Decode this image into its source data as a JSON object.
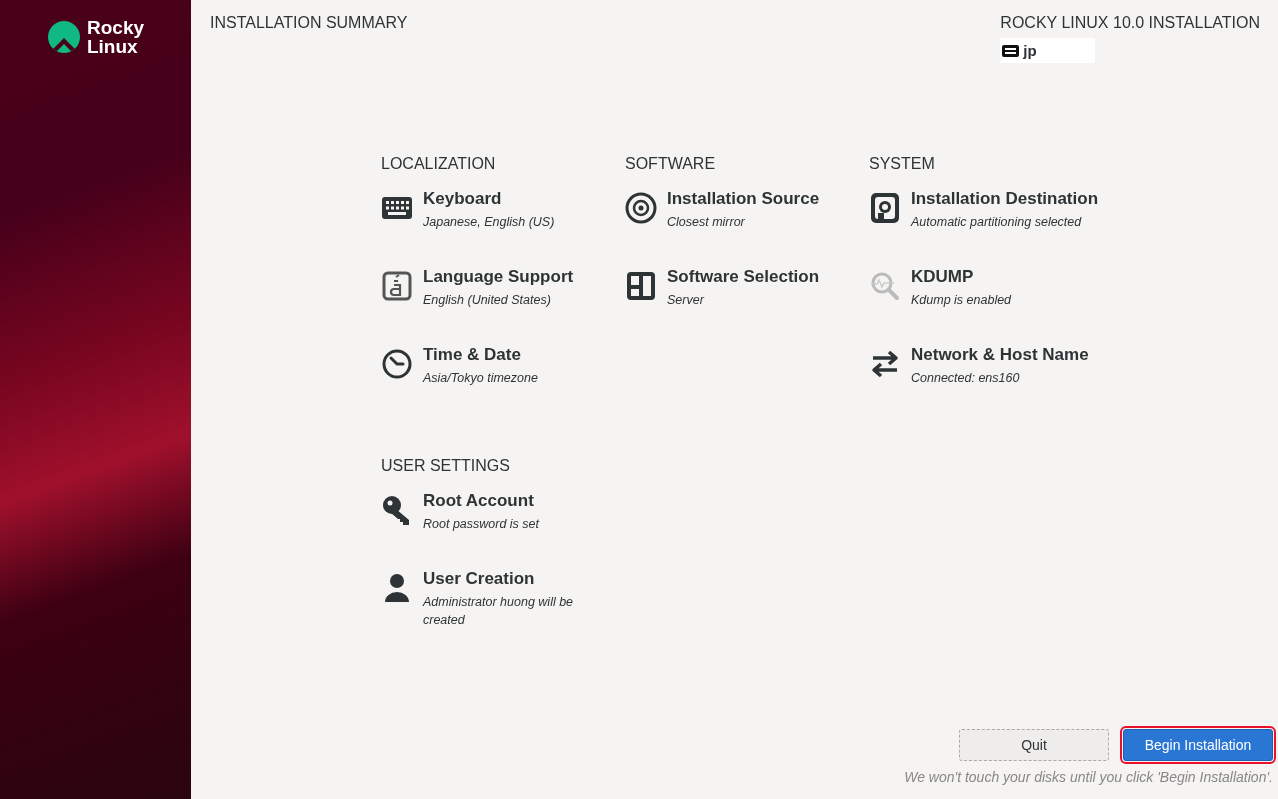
{
  "sidebar": {
    "logo_text": [
      "Rocky",
      "Linux"
    ]
  },
  "header": {
    "title": "INSTALLATION SUMMARY",
    "product": "ROCKY LINUX 10.0 INSTALLATION",
    "keyboard_layout": "jp"
  },
  "sections": [
    {
      "title": "LOCALIZATION",
      "spokes": [
        {
          "kind": "keyboard",
          "title": "Keyboard",
          "status": "Japanese, English (US)"
        },
        {
          "kind": "language",
          "title": "Language Support",
          "status": "English (United States)"
        },
        {
          "kind": "clock",
          "title": "Time & Date",
          "status": "Asia/Tokyo timezone"
        }
      ]
    },
    {
      "title": "SOFTWARE",
      "spokes": [
        {
          "kind": "source",
          "title": "Installation Source",
          "status": "Closest mirror"
        },
        {
          "kind": "packages",
          "title": "Software Selection",
          "status": "Server"
        }
      ]
    },
    {
      "title": "SYSTEM",
      "spokes": [
        {
          "kind": "disk",
          "title": "Installation Destination",
          "status": "Automatic partitioning selected"
        },
        {
          "kind": "kdump",
          "title": "KDUMP",
          "status": "Kdump is enabled"
        },
        {
          "kind": "network",
          "title": "Network & Host Name",
          "status": "Connected: ens160"
        }
      ]
    },
    {
      "title": "USER SETTINGS",
      "spokes": [
        {
          "kind": "key",
          "title": "Root Account",
          "status": "Root password is set"
        },
        {
          "kind": "user",
          "title": "User Creation",
          "status": "Administrator huong will be created"
        }
      ]
    }
  ],
  "footer": {
    "buttons": [
      {
        "label": "Quit",
        "kind": "secondary",
        "highlighted": false
      },
      {
        "label": "Begin Installation",
        "kind": "primary",
        "highlighted": true
      }
    ],
    "note": "We won't touch your disks until you click 'Begin Installation'."
  }
}
